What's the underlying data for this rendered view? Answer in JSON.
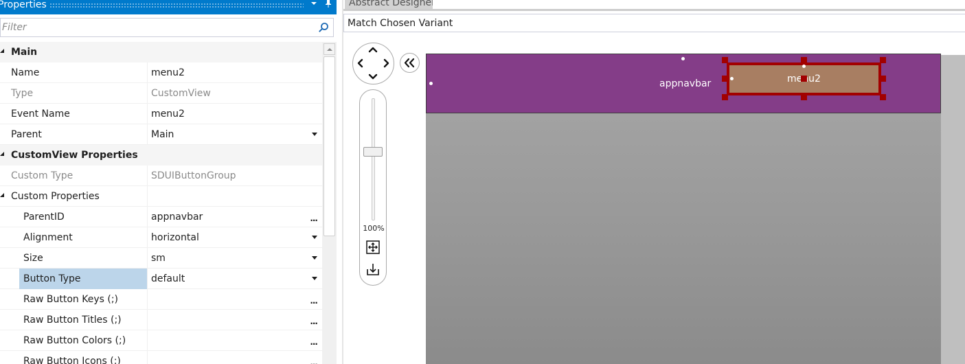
{
  "properties_panel": {
    "title": "Properties",
    "filter_placeholder": "Filter",
    "main_category": "Main",
    "rows_main": [
      {
        "name": "Name",
        "value": "menu2"
      },
      {
        "name": "Type",
        "value": "CustomView"
      },
      {
        "name": "Event Name",
        "value": "menu2"
      },
      {
        "name": "Parent",
        "value": "Main"
      }
    ],
    "customview_category": "CustomView Properties",
    "custom_type": {
      "name": "Custom Type",
      "value": "SDUIButtonGroup"
    },
    "custom_properties_label": "Custom Properties",
    "custom_rows": [
      {
        "name": "ParentID",
        "value": "appnavbar"
      },
      {
        "name": "Alignment",
        "value": "horizontal"
      },
      {
        "name": "Size",
        "value": "sm"
      },
      {
        "name": "Button Type",
        "value": "default"
      },
      {
        "name": "Raw Button Keys (;)",
        "value": ""
      },
      {
        "name": "Raw Button Titles (;)",
        "value": ""
      },
      {
        "name": "Raw Button Colors (;)",
        "value": ""
      },
      {
        "name": "Raw Button Icons (;)",
        "value": ""
      }
    ],
    "ellipsis": "..."
  },
  "designer": {
    "tab_title": "Abstract Designer",
    "variant_label": "Match Chosen Variant",
    "zoom_level": "100%",
    "zoom_fraction": 0.4,
    "navbar_label": "appnavbar",
    "selected_view_label": "menu2",
    "colors": {
      "navbar": "#843d88",
      "selected_view": "#a87e62",
      "selection_border": "#a20000",
      "title_bar": "#007acc",
      "selected_row": "#bcd5ea"
    }
  }
}
